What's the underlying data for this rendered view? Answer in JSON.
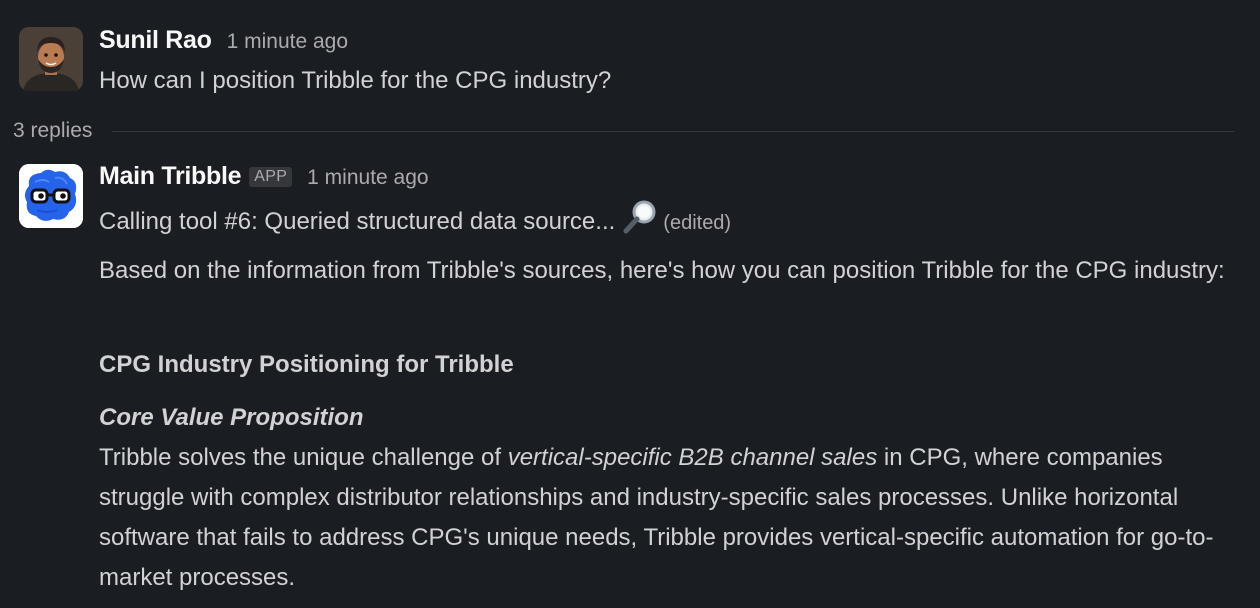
{
  "messages": [
    {
      "sender": "Sunil Rao",
      "timestamp": "1 minute ago",
      "text": "How can I position Tribble for the CPG industry?",
      "avatar_icon": "person-avatar-icon"
    }
  ],
  "thread": {
    "replies_label": "3 replies"
  },
  "reply": {
    "sender": "Main Tribble",
    "badge": "APP",
    "timestamp": "1 minute ago",
    "avatar_icon": "tribble-logo-icon",
    "status_text": "Calling tool #6: Queried structured data source...",
    "status_icon": "magnifying-glass-icon",
    "edited_label": "(edited)",
    "intro": "Based on the information from Tribble's sources, here's how you can position Tribble for the CPG industry:",
    "heading": "CPG Industry Positioning for Tribble",
    "subheading": "Core Value Proposition",
    "body_part1": "Tribble solves the unique challenge of ",
    "body_emphasis": "vertical-specific B2B channel sales",
    "body_part2": " in CPG, where companies struggle with complex distributor relationships and industry-specific sales processes. Unlike horizontal software that fails to address CPG's unique needs, Tribble provides vertical-specific automation for go-to-market processes."
  },
  "colors": {
    "background": "#1a1d21",
    "text": "#d1d2d3",
    "muted": "#ababad",
    "tribble_blue": "#2563eb"
  }
}
